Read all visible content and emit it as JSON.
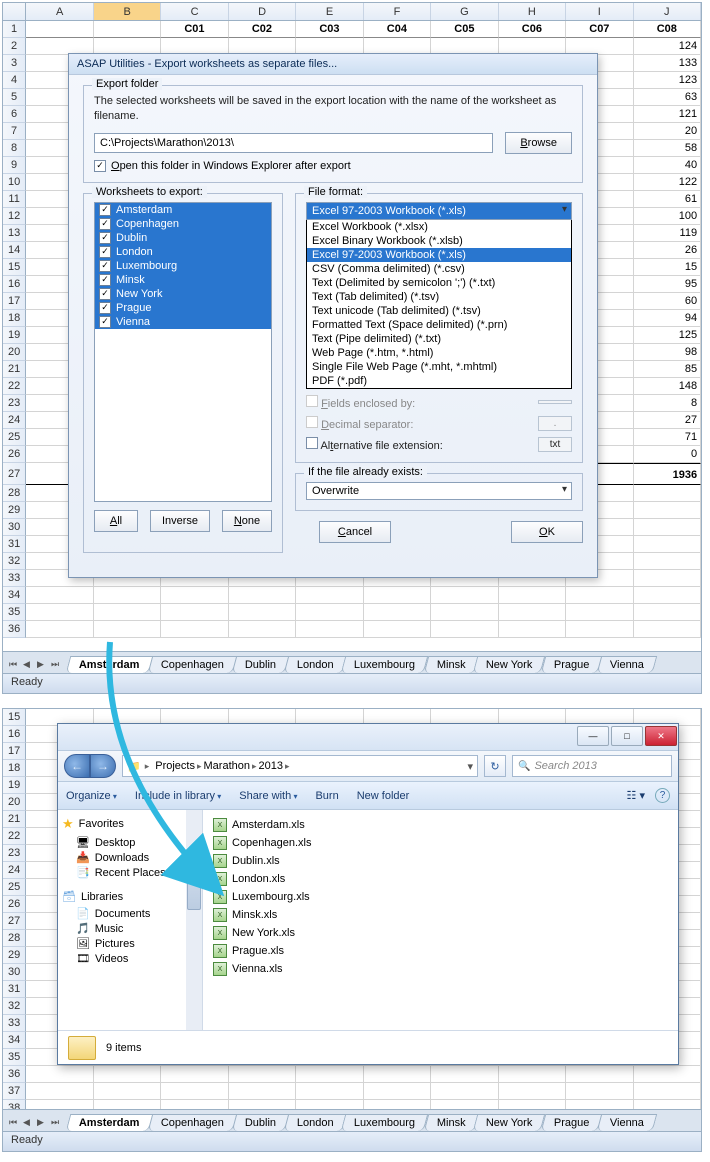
{
  "spreadsheet": {
    "columns": [
      "A",
      "B",
      "C",
      "D",
      "E",
      "F",
      "G",
      "H",
      "I",
      "J"
    ],
    "selected_col": "B",
    "header_row": [
      "",
      "",
      "C01",
      "C02",
      "C03",
      "C04",
      "C05",
      "C06",
      "C07",
      "C08"
    ],
    "rows_top": [
      {
        "n": 1,
        "vals": [
          "",
          "",
          "C01",
          "C02",
          "C03",
          "C04",
          "C05",
          "C06",
          "C07",
          "C08"
        ]
      },
      {
        "n": 2,
        "vals": [
          "",
          "",
          "",
          "",
          "",
          "",
          "",
          "",
          "",
          "124"
        ]
      },
      {
        "n": 3,
        "vals": [
          "",
          "",
          "",
          "",
          "",
          "",
          "",
          "",
          "",
          "133"
        ]
      },
      {
        "n": 4,
        "vals": [
          "",
          "",
          "",
          "",
          "",
          "",
          "",
          "",
          "",
          "123"
        ]
      },
      {
        "n": 5,
        "vals": [
          "",
          "",
          "",
          "",
          "",
          "",
          "",
          "",
          "",
          "63"
        ]
      },
      {
        "n": 6,
        "vals": [
          "",
          "",
          "",
          "",
          "",
          "",
          "",
          "",
          "",
          "121"
        ]
      },
      {
        "n": 7,
        "vals": [
          "",
          "",
          "",
          "",
          "",
          "",
          "",
          "",
          "",
          "20"
        ]
      },
      {
        "n": 8,
        "vals": [
          "",
          "",
          "",
          "",
          "",
          "",
          "",
          "",
          "",
          "58"
        ]
      },
      {
        "n": 9,
        "vals": [
          "",
          "",
          "",
          "",
          "",
          "",
          "",
          "",
          "",
          "40"
        ]
      },
      {
        "n": 10,
        "vals": [
          "",
          "",
          "",
          "",
          "",
          "",
          "",
          "",
          "",
          "122"
        ]
      },
      {
        "n": 11,
        "vals": [
          "",
          "",
          "",
          "",
          "",
          "",
          "",
          "",
          "",
          "61"
        ]
      },
      {
        "n": 12,
        "vals": [
          "",
          "",
          "",
          "",
          "",
          "",
          "",
          "",
          "",
          "100"
        ]
      },
      {
        "n": 13,
        "vals": [
          "",
          "",
          "",
          "",
          "",
          "",
          "",
          "",
          "",
          "119"
        ]
      },
      {
        "n": 14,
        "vals": [
          "",
          "",
          "",
          "",
          "",
          "",
          "",
          "",
          "",
          "26"
        ]
      },
      {
        "n": 15,
        "vals": [
          "",
          "",
          "",
          "",
          "",
          "",
          "",
          "",
          "",
          "15"
        ]
      },
      {
        "n": 16,
        "vals": [
          "",
          "",
          "",
          "",
          "",
          "",
          "",
          "",
          "",
          "95"
        ]
      },
      {
        "n": 17,
        "vals": [
          "",
          "",
          "",
          "",
          "",
          "",
          "",
          "",
          "",
          "60"
        ]
      },
      {
        "n": 18,
        "vals": [
          "",
          "",
          "",
          "",
          "",
          "",
          "",
          "",
          "",
          "94"
        ]
      },
      {
        "n": 19,
        "vals": [
          "",
          "",
          "",
          "",
          "",
          "",
          "",
          "",
          "",
          "125"
        ]
      },
      {
        "n": 20,
        "vals": [
          "",
          "",
          "",
          "",
          "",
          "",
          "",
          "",
          "",
          "98"
        ]
      },
      {
        "n": 21,
        "vals": [
          "",
          "",
          "",
          "",
          "",
          "",
          "",
          "",
          "",
          "85"
        ]
      },
      {
        "n": 22,
        "vals": [
          "",
          "",
          "",
          "",
          "",
          "",
          "",
          "",
          "",
          "148"
        ]
      },
      {
        "n": 23,
        "vals": [
          "",
          "",
          "",
          "",
          "",
          "",
          "",
          "",
          "",
          "8"
        ]
      },
      {
        "n": 24,
        "vals": [
          "",
          "",
          "",
          "",
          "",
          "",
          "",
          "",
          "",
          "27"
        ]
      },
      {
        "n": 25,
        "vals": [
          "",
          "",
          "",
          "",
          "",
          "",
          "",
          "",
          "",
          "71"
        ]
      },
      {
        "n": 26,
        "vals": [
          "",
          "",
          "",
          "",
          "",
          "",
          "",
          "",
          "",
          "0"
        ]
      },
      {
        "n": 27,
        "vals": [
          "",
          "",
          "",
          "",
          "",
          "",
          "",
          "",
          "",
          "1936"
        ]
      },
      {
        "n": 28,
        "vals": [
          "",
          "",
          "",
          "",
          "",
          "",
          "",
          "",
          "",
          ""
        ]
      },
      {
        "n": 29,
        "vals": [
          "",
          "",
          "",
          "",
          "",
          "",
          "",
          "",
          "",
          ""
        ]
      },
      {
        "n": 30,
        "vals": [
          "",
          "",
          "",
          "",
          "",
          "",
          "",
          "",
          "",
          ""
        ]
      },
      {
        "n": 31,
        "vals": [
          "",
          "",
          "",
          "",
          "",
          "",
          "",
          "",
          "",
          ""
        ]
      },
      {
        "n": 32,
        "vals": [
          "",
          "",
          "",
          "",
          "",
          "",
          "",
          "",
          "",
          ""
        ]
      },
      {
        "n": 33,
        "vals": [
          "",
          "",
          "",
          "",
          "",
          "",
          "",
          "",
          "",
          ""
        ]
      },
      {
        "n": 34,
        "vals": [
          "",
          "",
          "",
          "",
          "",
          "",
          "",
          "",
          "",
          ""
        ]
      },
      {
        "n": 35,
        "vals": [
          "",
          "",
          "",
          "",
          "",
          "",
          "",
          "",
          "",
          ""
        ]
      },
      {
        "n": 36,
        "vals": [
          "",
          "",
          "",
          "",
          "",
          "",
          "",
          "",
          "",
          ""
        ]
      }
    ],
    "rows_bottom_start": 15,
    "rows_bottom_count": 24,
    "tabs": [
      "Amsterdam",
      "Copenhagen",
      "Dublin",
      "London",
      "Luxembourg",
      "Minsk",
      "New York",
      "Prague",
      "Vienna"
    ],
    "active_tab": "Amsterdam",
    "status": "Ready"
  },
  "dialog": {
    "title": "ASAP Utilities - Export worksheets as separate files...",
    "export_folder_label": "Export folder",
    "description": "The selected worksheets will be saved in the export location with the name of the worksheet as filename.",
    "path": "C:\\Projects\\Marathon\\2013\\",
    "browse": "Browse",
    "open_folder_label": "Open this folder in Windows Explorer after export",
    "open_folder_checked": true,
    "ws_label": "Worksheets to export:",
    "worksheets": [
      "Amsterdam",
      "Copenhagen",
      "Dublin",
      "London",
      "Luxembourg",
      "Minsk",
      "New York",
      "Prague",
      "Vienna"
    ],
    "btn_all": "All",
    "btn_inverse": "Inverse",
    "btn_none": "None",
    "ff_label": "File format:",
    "ff_selected": "Excel 97-2003 Workbook (*.xls)",
    "ff_options": [
      "Excel Workbook (*.xlsx)",
      "Excel Binary Workbook (*.xlsb)",
      "Excel 97-2003 Workbook (*.xls)",
      "CSV (Comma delimited) (*.csv)",
      "Text (Delimited by semicolon ';') (*.txt)",
      "Text (Tab delimited) (*.tsv)",
      "Text unicode (Tab delimited) (*.tsv)",
      "Formatted Text (Space delimited) (*.prn)",
      "Text (Pipe delimited) (*.txt)",
      "Web Page (*.htm, *.html)",
      "Single File Web Page (*.mht, *.mhtml)",
      "PDF (*.pdf)"
    ],
    "fields_enclosed": "Fields enclosed by:",
    "decimal_sep": "Decimal separator:",
    "alt_ext": "Alternative file extension:",
    "alt_ext_val": "txt",
    "exists_label": "If the file already exists:",
    "exists_value": "Overwrite",
    "cancel": "Cancel",
    "ok": "OK"
  },
  "explorer": {
    "crumbs": [
      "Projects",
      "Marathon",
      "2013"
    ],
    "search_placeholder": "Search 2013",
    "toolbar": [
      "Organize",
      "Include in library",
      "Share with",
      "Burn",
      "New folder"
    ],
    "favorites_label": "Favorites",
    "favorites": [
      "Desktop",
      "Downloads",
      "Recent Places"
    ],
    "libraries_label": "Libraries",
    "libraries": [
      "Documents",
      "Music",
      "Pictures",
      "Videos"
    ],
    "files": [
      "Amsterdam.xls",
      "Copenhagen.xls",
      "Dublin.xls",
      "London.xls",
      "Luxembourg.xls",
      "Minsk.xls",
      "New York.xls",
      "Prague.xls",
      "Vienna.xls"
    ],
    "status": "9 items"
  }
}
